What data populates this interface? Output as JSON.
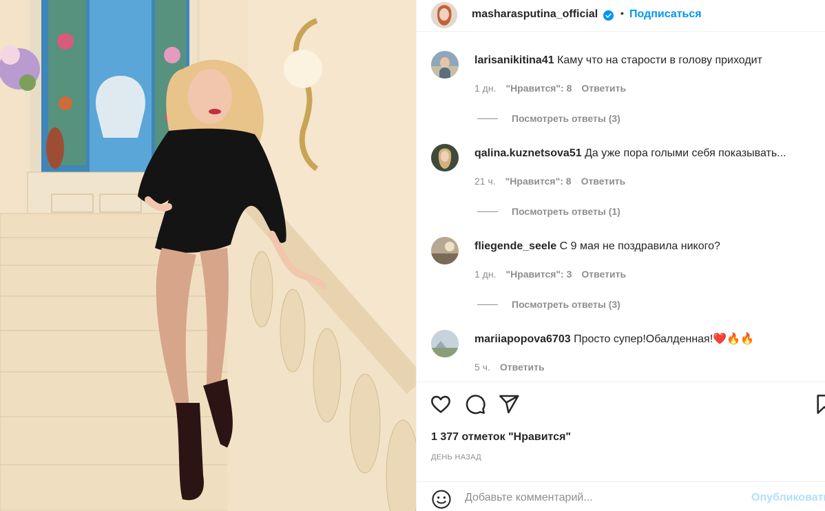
{
  "header": {
    "username": "masharasputina_official",
    "separator": "•",
    "follow_label": "Подписаться"
  },
  "comments": [
    {
      "user": "larisanikitina41",
      "text": "Каму что на старости в голову приходит",
      "time": "1 дн.",
      "likes": "\"Нравится\": 8",
      "reply_label": "Ответить",
      "view_replies": "Посмотреть ответы (3)"
    },
    {
      "user": "qalina.kuznetsova51",
      "text": "Да уже пора голыми себя показывать...",
      "time": "21 ч.",
      "likes": "\"Нравится\": 8",
      "reply_label": "Ответить",
      "view_replies": "Посмотреть ответы (1)"
    },
    {
      "user": "fliegende_seele",
      "text": "С 9 мая не поздравила никого?",
      "time": "1 дн.",
      "likes": "\"Нравится\": 3",
      "reply_label": "Ответить",
      "view_replies": "Посмотреть ответы (3)"
    },
    {
      "user": "mariiapopova6703",
      "text": "Просто супер!Обалденная!❤️🔥🔥",
      "time": "5 ч.",
      "reply_label": "Ответить"
    }
  ],
  "actions": {
    "like_icon": "heart-icon",
    "comment_icon": "comment-icon",
    "share_icon": "share-icon",
    "save_icon": "bookmark-icon",
    "likes_count": "1 377 отметок \"Нравится\"",
    "time_ago": "ДЕНЬ НАЗАД"
  },
  "comment_box": {
    "placeholder": "Добавьте комментарий...",
    "publish_label": "Опубликовать",
    "emoji_icon": "smiley-icon"
  },
  "colors": {
    "link_blue": "#0095f6",
    "muted": "#8e8e8e",
    "publish_disabled": "#b2dffc"
  }
}
